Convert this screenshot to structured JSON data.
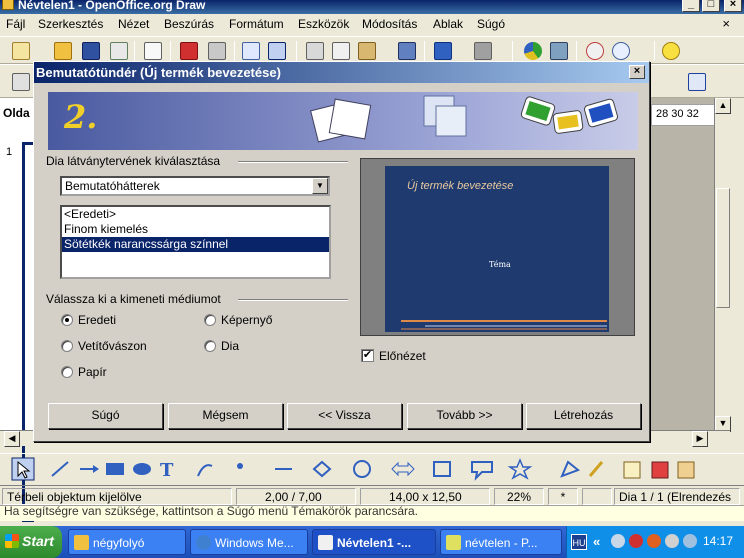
{
  "window": {
    "title": "Névtelen1 - OpenOffice.org Draw",
    "minimize": "_",
    "maximize": "□",
    "close": "×"
  },
  "menu": {
    "items": [
      "Fájl",
      "Szerkesztés",
      "Nézet",
      "Beszúrás",
      "Formátum",
      "Eszközök",
      "Módosítás",
      "Ablak",
      "Súgó"
    ],
    "doc_close": "×"
  },
  "left_panel": {
    "title": "Olda",
    "slide_number": "1"
  },
  "ruler": {
    "text": "28 30 32"
  },
  "dialog": {
    "title": "Bemutatótündér (Új termék bevezetése)",
    "close": "×",
    "step": "2.",
    "design_group_label": "Dia látványtervének kiválasztása",
    "category_select": "Bemutatóhátterek",
    "designs": [
      "<Eredeti>",
      "Finom kiemelés",
      "Sötétkék narancssárga színnel"
    ],
    "selected_design_index": 2,
    "medium_group_label": "Válassza ki a kimeneti médiumot",
    "media": {
      "original": "Eredeti",
      "overhead": "Vetítővászon",
      "paper": "Papír",
      "screen": "Képernyő",
      "slide": "Dia",
      "selected": "original"
    },
    "preview": {
      "title": "Új termék bevezetése",
      "body": "Téma",
      "checkbox_label": "Előnézet",
      "checked": true
    },
    "buttons": {
      "help": "Súgó",
      "cancel": "Mégsem",
      "back": "<< Vissza",
      "next": "Tovább >>",
      "create": "Létrehozás"
    }
  },
  "statusbar": {
    "message": "Térbeli objektum kijelölve",
    "position": "2,00 / 7,00",
    "size": "14,00 x 12,50",
    "zoom": "22%",
    "modified": "*",
    "page": "Dia 1 / 1 (Elrendezés"
  },
  "help_line": "Ha segítségre van szüksége, kattintson a Súgó menü Témakörök parancsára.",
  "taskbar": {
    "start": "Start",
    "tasks": [
      "négyfolyó",
      "Windows Me...",
      "Névtelen1 -...",
      "névtelen - P..."
    ],
    "active_task_index": 2,
    "language": "HU",
    "tray_arrow": "«",
    "clock": "14:17"
  },
  "colors": {
    "titlebar": "#0a246a",
    "dialog_face": "#d4d0c8",
    "selection": "#0a246a",
    "preview_slide": "#1e3a6e",
    "accent_orange": "#e08a4a",
    "taskbar": "#245edb"
  }
}
